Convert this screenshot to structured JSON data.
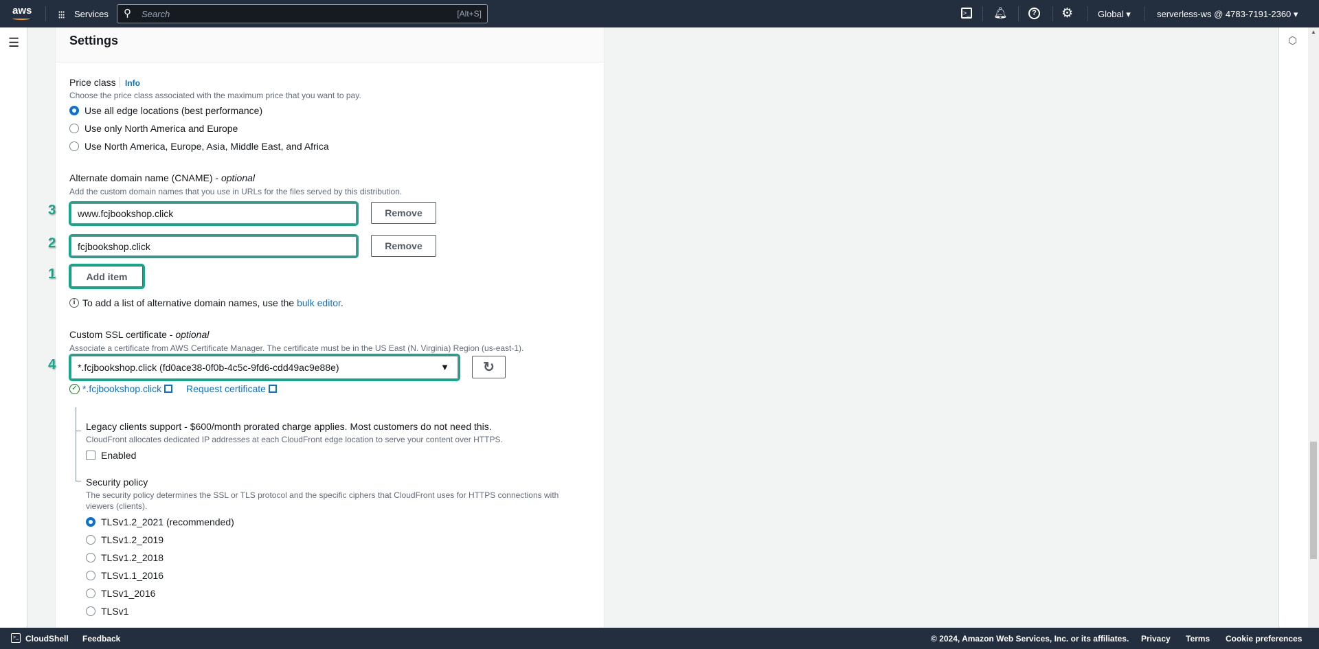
{
  "topbar": {
    "logo": "aws",
    "services": "Services",
    "search_placeholder": "Search",
    "search_shortcut": "[Alt+S]",
    "region": "Global",
    "account": "serverless-ws @ 4783-7191-2360"
  },
  "settings": {
    "title": "Settings",
    "price_class": {
      "label": "Price class",
      "info": "Info",
      "description": "Choose the price class associated with the maximum price that you want to pay.",
      "options": [
        "Use all edge locations (best performance)",
        "Use only North America and Europe",
        "Use North America, Europe, Asia, Middle East, and Africa"
      ],
      "selected": 0
    },
    "cname": {
      "label": "Alternate domain name (CNAME) - ",
      "optional": "optional",
      "description": "Add the custom domain names that you use in URLs for the files served by this distribution.",
      "items": [
        "www.fcjbookshop.click",
        "fcjbookshop.click"
      ],
      "remove": "Remove",
      "add_item": "Add item",
      "hint_prefix": "To add a list of alternative domain names, use the ",
      "hint_link": "bulk editor",
      "hint_suffix": "."
    },
    "ssl": {
      "label": "Custom SSL certificate - ",
      "optional": "optional",
      "description": "Associate a certificate from AWS Certificate Manager. The certificate must be in the US East (N. Virginia) Region (us-east-1).",
      "selected": "*.fcjbookshop.click (fd0ace38-0f0b-4c5c-9fd6-cdd49ac9e88e)",
      "cert_link": "*.fcjbookshop.click",
      "request_link": "Request certificate"
    },
    "legacy": {
      "label": "Legacy clients support - $600/month prorated charge applies. Most customers do not need this.",
      "description": "CloudFront allocates dedicated IP addresses at each CloudFront edge location to serve your content over HTTPS.",
      "checkbox": "Enabled",
      "checked": false
    },
    "security_policy": {
      "label": "Security policy",
      "description_1": "The security policy determines the SSL or TLS protocol and the specific ciphers that CloudFront uses for HTTPS connections with",
      "description_2": "viewers (clients).",
      "options": [
        "TLSv1.2_2021 (recommended)",
        "TLSv1.2_2019",
        "TLSv1.2_2018",
        "TLSv1.1_2016",
        "TLSv1_2016",
        "TLSv1"
      ],
      "selected": 0
    }
  },
  "annotations": [
    "3",
    "2",
    "1",
    "4"
  ],
  "footer": {
    "cloudshell": "CloudShell",
    "feedback": "Feedback",
    "copyright": "© 2024, Amazon Web Services, Inc. or its affiliates.",
    "privacy": "Privacy",
    "terms": "Terms",
    "cookies": "Cookie preferences"
  },
  "colors": {
    "highlight": "#14a88a",
    "accent": "#0972d3",
    "topbar": "#232f3e"
  }
}
